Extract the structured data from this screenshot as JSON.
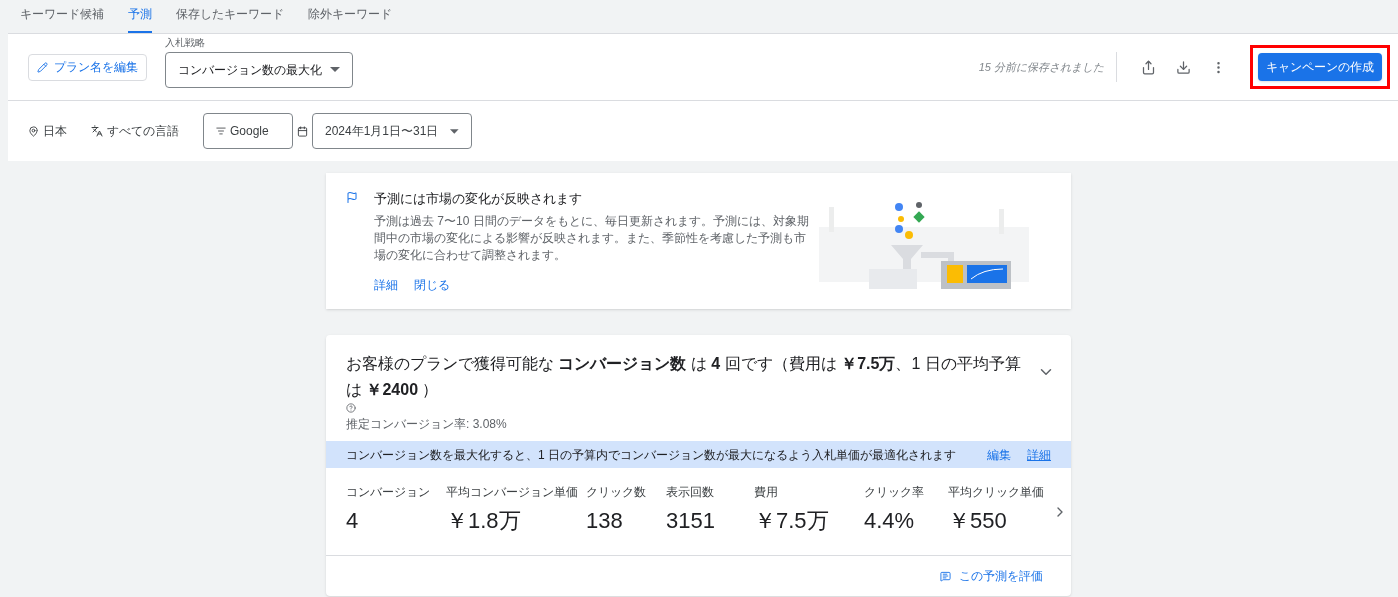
{
  "tabs": [
    {
      "label": "キーワード候補",
      "selected": false
    },
    {
      "label": "予測",
      "selected": true
    },
    {
      "label": "保存したキーワード",
      "selected": false
    },
    {
      "label": "除外キーワード",
      "selected": false
    }
  ],
  "toolbar": {
    "edit_plan_button": "プラン名を編集",
    "bid_strategy": {
      "label": "入札戦略",
      "value": "コンバージョン数の最大化"
    },
    "saved_status": "15 分前に保存されました",
    "create_campaign_button": {
      "label": "キャンペーンの作成",
      "highlighted": true
    }
  },
  "filters": {
    "location": "日本",
    "language": "すべての言語",
    "network": "Google",
    "date_range": "2024年1月1日〜31日"
  },
  "notice": {
    "title": "予測には市場の変化が反映されます",
    "body": "予測は過去 7〜10 日間のデータをもとに、毎日更新されます。予測には、対象期間中の市場の変化による影響が反映されます。また、季節性を考慮した予測も市場の変化に合わせて調整されます。",
    "links": [
      "詳細",
      "閉じる"
    ]
  },
  "forecast": {
    "headline": "お客様のプランで獲得可能な **コンバージョン数** は **4** 回です（費用は **￥7.5万**、1 日の平均予算は **￥2400** ）",
    "expanded": false,
    "rate": "推定コンバージョン率: 3.08%",
    "banner": {
      "text": "コンバージョン数を最大化すると、1 日の予算内でコンバージョン数が最大になるよう入札単価が最適化されます",
      "links": [
        "編集",
        "詳細"
      ]
    },
    "metrics": [
      {
        "label": "コンバージョン",
        "value": "4"
      },
      {
        "label": "平均コンバージョン単価",
        "value": "￥1.8万"
      },
      {
        "label": "クリック数",
        "value": "138"
      },
      {
        "label": "表示回数",
        "value": "3151"
      },
      {
        "label": "費用",
        "value": "￥7.5万"
      },
      {
        "label": "クリック率",
        "value": "4.4%"
      },
      {
        "label": "平均クリック単価",
        "value": "￥550"
      }
    ],
    "feedback_link": "この予測を評価"
  }
}
